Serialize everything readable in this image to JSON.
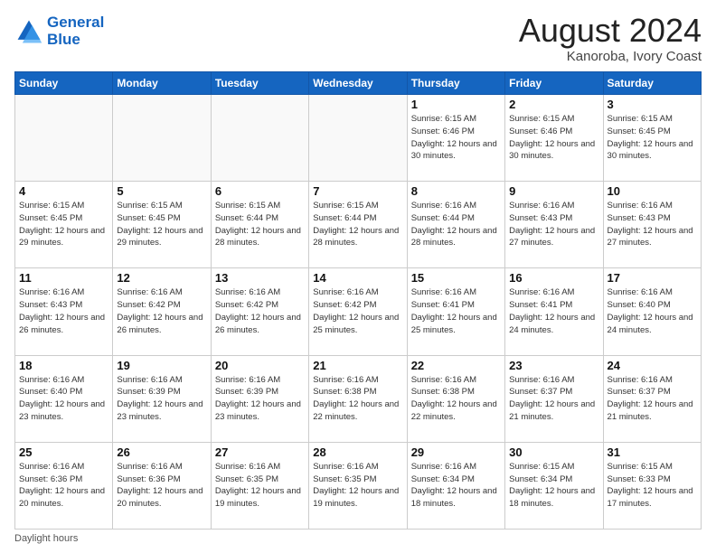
{
  "logo": {
    "line1": "General",
    "line2": "Blue"
  },
  "title": {
    "month_year": "August 2024",
    "location": "Kanoroba, Ivory Coast"
  },
  "headers": [
    "Sunday",
    "Monday",
    "Tuesday",
    "Wednesday",
    "Thursday",
    "Friday",
    "Saturday"
  ],
  "footer": {
    "daylight_label": "Daylight hours"
  },
  "weeks": [
    [
      {
        "day": "",
        "info": "",
        "empty": true
      },
      {
        "day": "",
        "info": "",
        "empty": true
      },
      {
        "day": "",
        "info": "",
        "empty": true
      },
      {
        "day": "",
        "info": "",
        "empty": true
      },
      {
        "day": "1",
        "info": "Sunrise: 6:15 AM\nSunset: 6:46 PM\nDaylight: 12 hours\nand 30 minutes."
      },
      {
        "day": "2",
        "info": "Sunrise: 6:15 AM\nSunset: 6:46 PM\nDaylight: 12 hours\nand 30 minutes."
      },
      {
        "day": "3",
        "info": "Sunrise: 6:15 AM\nSunset: 6:45 PM\nDaylight: 12 hours\nand 30 minutes."
      }
    ],
    [
      {
        "day": "4",
        "info": "Sunrise: 6:15 AM\nSunset: 6:45 PM\nDaylight: 12 hours\nand 29 minutes."
      },
      {
        "day": "5",
        "info": "Sunrise: 6:15 AM\nSunset: 6:45 PM\nDaylight: 12 hours\nand 29 minutes."
      },
      {
        "day": "6",
        "info": "Sunrise: 6:15 AM\nSunset: 6:44 PM\nDaylight: 12 hours\nand 28 minutes."
      },
      {
        "day": "7",
        "info": "Sunrise: 6:15 AM\nSunset: 6:44 PM\nDaylight: 12 hours\nand 28 minutes."
      },
      {
        "day": "8",
        "info": "Sunrise: 6:16 AM\nSunset: 6:44 PM\nDaylight: 12 hours\nand 28 minutes."
      },
      {
        "day": "9",
        "info": "Sunrise: 6:16 AM\nSunset: 6:43 PM\nDaylight: 12 hours\nand 27 minutes."
      },
      {
        "day": "10",
        "info": "Sunrise: 6:16 AM\nSunset: 6:43 PM\nDaylight: 12 hours\nand 27 minutes."
      }
    ],
    [
      {
        "day": "11",
        "info": "Sunrise: 6:16 AM\nSunset: 6:43 PM\nDaylight: 12 hours\nand 26 minutes."
      },
      {
        "day": "12",
        "info": "Sunrise: 6:16 AM\nSunset: 6:42 PM\nDaylight: 12 hours\nand 26 minutes."
      },
      {
        "day": "13",
        "info": "Sunrise: 6:16 AM\nSunset: 6:42 PM\nDaylight: 12 hours\nand 26 minutes."
      },
      {
        "day": "14",
        "info": "Sunrise: 6:16 AM\nSunset: 6:42 PM\nDaylight: 12 hours\nand 25 minutes."
      },
      {
        "day": "15",
        "info": "Sunrise: 6:16 AM\nSunset: 6:41 PM\nDaylight: 12 hours\nand 25 minutes."
      },
      {
        "day": "16",
        "info": "Sunrise: 6:16 AM\nSunset: 6:41 PM\nDaylight: 12 hours\nand 24 minutes."
      },
      {
        "day": "17",
        "info": "Sunrise: 6:16 AM\nSunset: 6:40 PM\nDaylight: 12 hours\nand 24 minutes."
      }
    ],
    [
      {
        "day": "18",
        "info": "Sunrise: 6:16 AM\nSunset: 6:40 PM\nDaylight: 12 hours\nand 23 minutes."
      },
      {
        "day": "19",
        "info": "Sunrise: 6:16 AM\nSunset: 6:39 PM\nDaylight: 12 hours\nand 23 minutes."
      },
      {
        "day": "20",
        "info": "Sunrise: 6:16 AM\nSunset: 6:39 PM\nDaylight: 12 hours\nand 23 minutes."
      },
      {
        "day": "21",
        "info": "Sunrise: 6:16 AM\nSunset: 6:38 PM\nDaylight: 12 hours\nand 22 minutes."
      },
      {
        "day": "22",
        "info": "Sunrise: 6:16 AM\nSunset: 6:38 PM\nDaylight: 12 hours\nand 22 minutes."
      },
      {
        "day": "23",
        "info": "Sunrise: 6:16 AM\nSunset: 6:37 PM\nDaylight: 12 hours\nand 21 minutes."
      },
      {
        "day": "24",
        "info": "Sunrise: 6:16 AM\nSunset: 6:37 PM\nDaylight: 12 hours\nand 21 minutes."
      }
    ],
    [
      {
        "day": "25",
        "info": "Sunrise: 6:16 AM\nSunset: 6:36 PM\nDaylight: 12 hours\nand 20 minutes."
      },
      {
        "day": "26",
        "info": "Sunrise: 6:16 AM\nSunset: 6:36 PM\nDaylight: 12 hours\nand 20 minutes."
      },
      {
        "day": "27",
        "info": "Sunrise: 6:16 AM\nSunset: 6:35 PM\nDaylight: 12 hours\nand 19 minutes."
      },
      {
        "day": "28",
        "info": "Sunrise: 6:16 AM\nSunset: 6:35 PM\nDaylight: 12 hours\nand 19 minutes."
      },
      {
        "day": "29",
        "info": "Sunrise: 6:16 AM\nSunset: 6:34 PM\nDaylight: 12 hours\nand 18 minutes."
      },
      {
        "day": "30",
        "info": "Sunrise: 6:15 AM\nSunset: 6:34 PM\nDaylight: 12 hours\nand 18 minutes."
      },
      {
        "day": "31",
        "info": "Sunrise: 6:15 AM\nSunset: 6:33 PM\nDaylight: 12 hours\nand 17 minutes."
      }
    ]
  ]
}
